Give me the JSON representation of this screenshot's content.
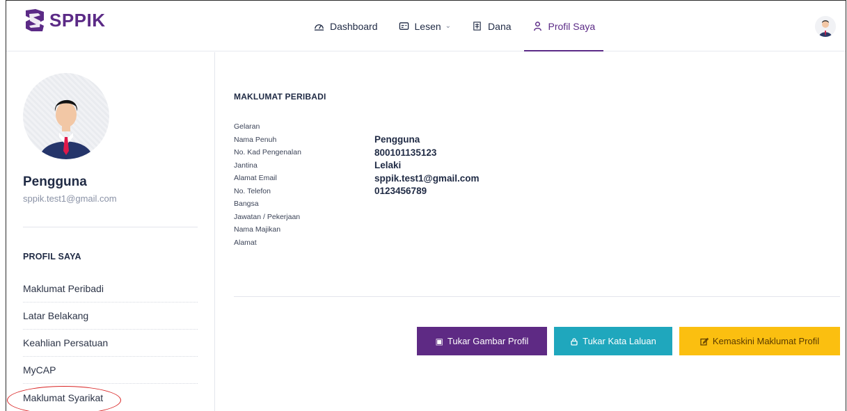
{
  "app": {
    "logo_text": "SPPIK",
    "brand_color": "#5b2a86"
  },
  "nav": {
    "items": [
      {
        "label": "Dashboard",
        "icon": "dashboard-icon"
      },
      {
        "label": "Lesen",
        "icon": "license-icon",
        "has_dropdown": true
      },
      {
        "label": "Dana",
        "icon": "fund-icon"
      },
      {
        "label": "Profil Saya",
        "icon": "user-icon",
        "active": true
      }
    ]
  },
  "sidebar": {
    "user_name": "Pengguna",
    "user_email": "sppik.test1@gmail.com",
    "heading": "PROFIL SAYA",
    "menu": [
      {
        "label": "Maklumat Peribadi"
      },
      {
        "label": "Latar Belakang"
      },
      {
        "label": "Keahlian Persatuan"
      },
      {
        "label": "MyCAP"
      },
      {
        "label": "Maklumat Syarikat",
        "highlighted": true
      }
    ]
  },
  "main": {
    "section_title": "MAKLUMAT PERIBADI",
    "fields": [
      {
        "label": "Gelaran",
        "value": ""
      },
      {
        "label": "Nama Penuh",
        "value": "Pengguna"
      },
      {
        "label": "No. Kad Pengenalan",
        "value": "800101135123"
      },
      {
        "label": "Jantina",
        "value": "Lelaki"
      },
      {
        "label": "Alamat Email",
        "value": "sppik.test1@gmail.com"
      },
      {
        "label": "No. Telefon",
        "value": "0123456789"
      },
      {
        "label": "Bangsa",
        "value": ""
      },
      {
        "label": "Jawatan / Pekerjaan",
        "value": ""
      },
      {
        "label": "Nama Majikan",
        "value": ""
      },
      {
        "label": "Alamat",
        "value": ""
      }
    ],
    "buttons": {
      "change_photo": {
        "label": "Tukar Gambar Profil",
        "icon": "image-icon",
        "color": "#5e2a84"
      },
      "change_password": {
        "label": "Tukar Kata Laluan",
        "icon": "lock-icon",
        "color": "#1fa7bd"
      },
      "update_profile": {
        "label": "Kemaskini Maklumat Profil",
        "icon": "edit-icon",
        "color": "#fbbf10"
      }
    }
  }
}
